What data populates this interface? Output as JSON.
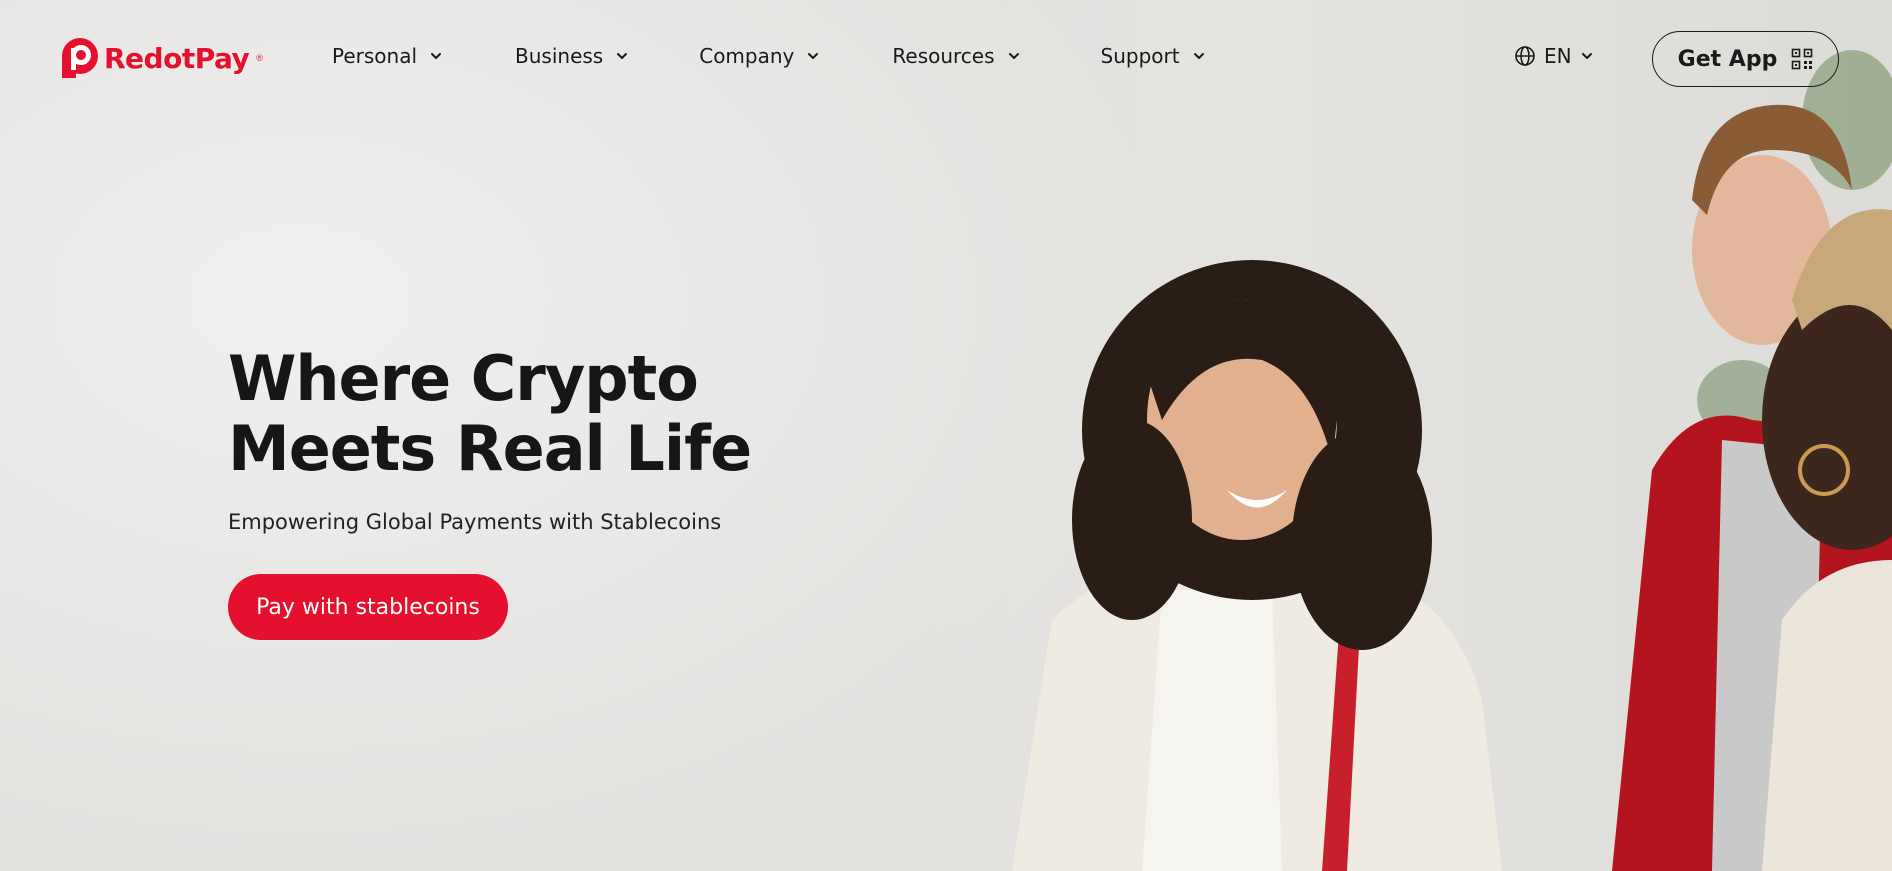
{
  "brand": {
    "name": "RedotPay",
    "registered_mark": "®",
    "accent_color": "#e4102e"
  },
  "nav": {
    "items": [
      {
        "label": "Personal",
        "icon": "chevron-down-icon"
      },
      {
        "label": "Business",
        "icon": "chevron-down-icon"
      },
      {
        "label": "Company",
        "icon": "chevron-down-icon"
      },
      {
        "label": "Resources",
        "icon": "chevron-down-icon"
      },
      {
        "label": "Support",
        "icon": "chevron-down-icon"
      }
    ]
  },
  "language": {
    "label": "EN",
    "icon": "globe-icon"
  },
  "get_app": {
    "label": "Get App",
    "icon": "qr-code-icon"
  },
  "hero": {
    "title_line1": "Where Crypto",
    "title_line2": "Meets Real Life",
    "subtitle": "Empowering Global Payments with Stablecoins",
    "cta_label": "Pay with stablecoins",
    "image": "hero-photo"
  }
}
